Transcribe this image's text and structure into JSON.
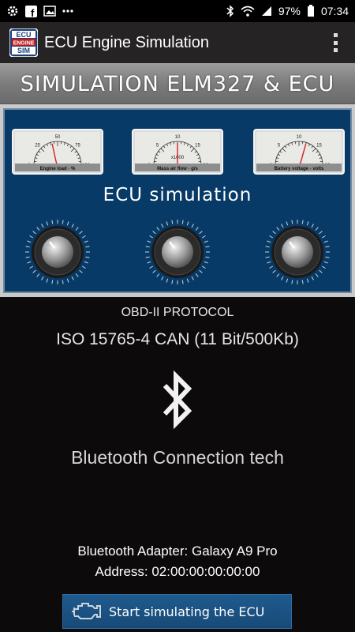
{
  "status_bar": {
    "battery": "97%",
    "time": "07:34",
    "left_icons": [
      "settings-icon",
      "facebook-icon",
      "image-icon",
      "more-icon"
    ],
    "right_icons": [
      "bluetooth-icon",
      "wifi-icon",
      "signal-icon",
      "battery-icon"
    ]
  },
  "app_bar": {
    "logo_lines": [
      "ECU",
      "ENGINE",
      "SIM"
    ],
    "title": "ECU Engine Simulation"
  },
  "banner": {
    "text": "SIMULATION ELM327 & ECU"
  },
  "simulator": {
    "label": "ECU simulation",
    "gauges": [
      {
        "ticks": [
          "0",
          "25",
          "50",
          "75",
          "100"
        ],
        "caption": "Engine load - %",
        "multiplier": "",
        "value_fraction": 0.42
      },
      {
        "ticks": [
          "0",
          "5",
          "10",
          "15",
          "20"
        ],
        "caption": "Mass air flow - g/s",
        "multiplier": "x1000",
        "value_fraction": 0.5
      },
      {
        "ticks": [
          "0",
          "5",
          "10",
          "15",
          "20"
        ],
        "caption": "Battery voltage - volts",
        "multiplier": "",
        "value_fraction": 0.6
      }
    ]
  },
  "protocol": {
    "label": "OBD-II PROTOCOL",
    "value": "ISO 15765-4 CAN (11 Bit/500Kb)"
  },
  "bluetooth": {
    "tech_label": "Bluetooth Connection tech",
    "adapter": "Bluetooth Adapter: Galaxy A9 Pro",
    "address": "Address: 02:00:00:00:00:00"
  },
  "actions": {
    "start_label": "Start simulating the ECU"
  },
  "colors": {
    "panel": "#073a66",
    "button": "#1b5283",
    "banner": "#8a8a8a"
  }
}
